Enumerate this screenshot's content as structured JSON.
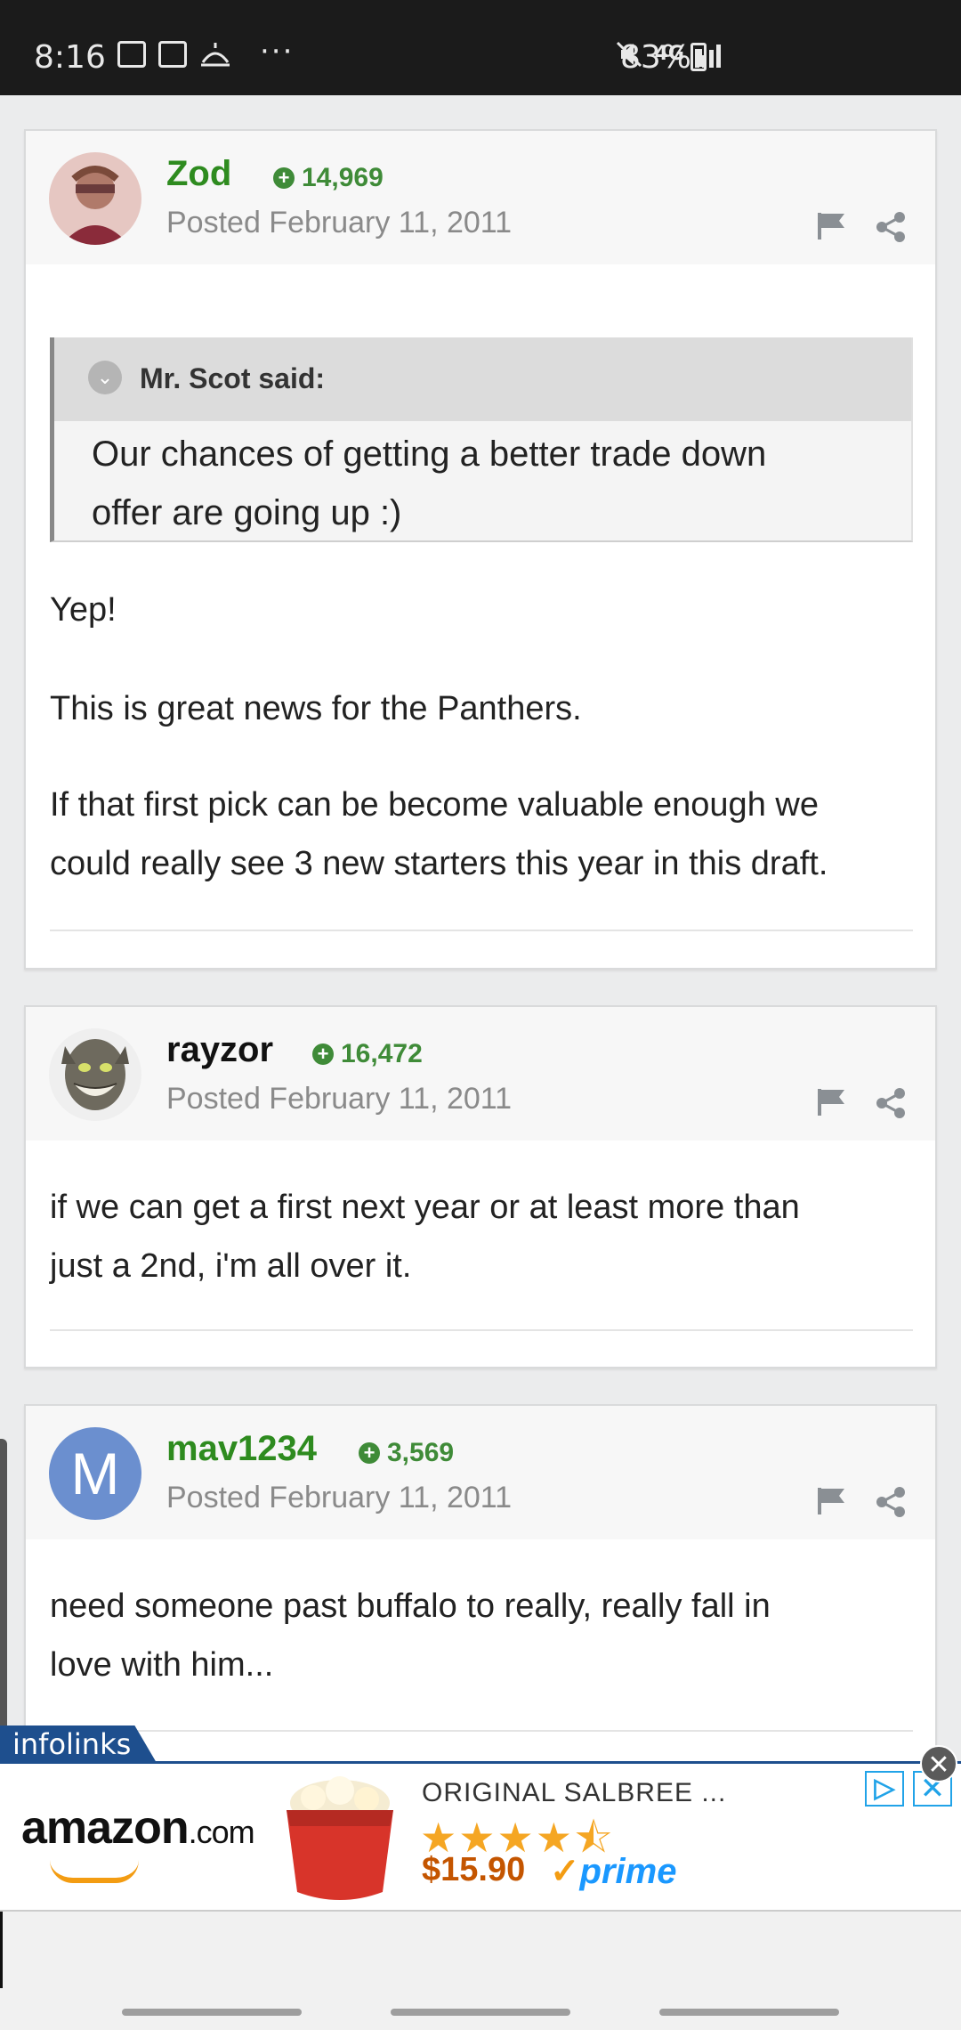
{
  "status_bar": {
    "time": "8:16",
    "overflow": "···",
    "network": "4G",
    "battery_pct": "83%"
  },
  "posts": [
    {
      "username": "Zod",
      "username_color": "#2e8b1f",
      "reputation": "14,969",
      "posted": "Posted February 11, 2011",
      "quote": {
        "author": "Mr. Scot said:",
        "lines": [
          "Our chances of getting a better trade down",
          "offer are going up :)"
        ]
      },
      "paragraphs": [
        [
          "Yep!"
        ],
        [
          "This is great news for the Panthers."
        ],
        [
          "If that first pick can be become valuable enough we",
          "could really see 3 new starters this year in this draft."
        ]
      ]
    },
    {
      "username": "rayzor",
      "username_color": "#111111",
      "reputation": "16,472",
      "posted": "Posted February 11, 2011",
      "paragraphs": [
        [
          "if we can get a first next year or at least more than",
          "just a 2nd, i'm all over it."
        ]
      ]
    },
    {
      "username": "mav1234",
      "username_color": "#2e8b1f",
      "reputation": "3,569",
      "posted": "Posted February 11, 2011",
      "avatar_letter": "M",
      "avatar_color": "#6b8fcf",
      "paragraphs": [
        [
          "need someone past buffalo to really, really fall in",
          "love with him..."
        ]
      ]
    }
  ],
  "ad": {
    "network_tag": "infolinks",
    "brand": "amazon",
    "brand_suffix": ".com",
    "title": "ORIGINAL SALBREE ...",
    "stars": "★★★★⯪",
    "rating": 4.5,
    "price": "$15.90",
    "prime_check": "✓",
    "prime": "prime",
    "close": "✕",
    "adchoice": "▷",
    "ad_x": "✕"
  }
}
